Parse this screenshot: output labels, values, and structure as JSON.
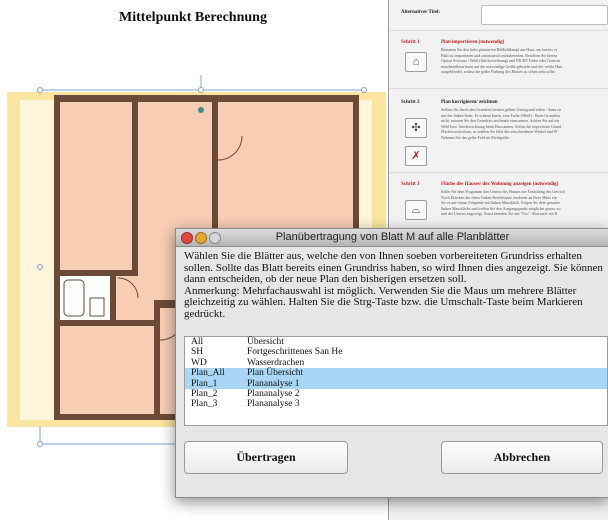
{
  "document": {
    "title": "Mittelpunkt Berechnung"
  },
  "right_panel": {
    "alt_title_label": "Alternativer Titel:",
    "alt_title_value": "",
    "steps": [
      {
        "step": "Schritt 1",
        "title": "Plan importieren (notwendig)",
        "text": [
          "Benutzen Sie den links platzierten Bildbildknopf um Haus, am bereits ei",
          "Blatt zu importieren und automatisch aufzubereiten. Beachten Sie hierzu",
          "Option Schwarz / Weiß (Strichzeichnung) und NICHT Farbe oder Graustu",
          "maschinelleserlesen auf die notwendige Größe gebracht und der weiße Hint",
          "ausgeblendet, sodass die gelbe Färbung des Blattes zu sehen sein sollte."
        ]
      },
      {
        "step": "Schritt 2",
        "title": "Plan korrigieren/ zeichnen",
        "text": [
          "Sollten Sie durch den Grundriss keinen gelben Untergrund sehen - dann zu",
          "mit der linken Seite. Es scheint Innen, eine Farbe (Weiß) - Ihren Grundriss",
          "nicht, müssen Sie den Grundriss nochmals einscannen. Achten Sie auf ein",
          "Weiß bzw. Strichzeichnung beim Einscannen. Sollen die importierte Grund",
          "Flächen aufweisen, so wählen Sie hilfe die verschiedenen Winkel und W",
          "Nehmen Sie das gelbe Feld als Richtgröße."
        ]
      },
      {
        "step": "Schritt 3",
        "title": "Fläche des Hauses/ der Wohnung anzeigen (notwendig)",
        "text": [
          "Sollte Sie dem Programm den Umriss des Hauses zur Ermittlung des Gewich",
          "Noch Drücken der obere linken Befehlstaste erscheint an Ihrer Maus ein",
          "Sie es auf einem Eckpunkt mit linken Mausklick. Folgen Sie dem gesamte",
          "linken Mausklicks und treffen Sie den Ausgangspunkt möglichst genau, so",
          "und der Umriss angezeigt. Sonst beenden Sie mit \"Esc\". Alternativ ein K"
        ]
      }
    ]
  },
  "dialog": {
    "title": "Planübertragung von Blatt M auf alle Planblätter",
    "message_lines": [
      "Wählen Sie die Blätter aus, welche den von Ihnen soeben vorbereiteten Grundriss erhalten",
      "sollen. Sollte das Blatt bereits einen Grundriss haben, so wird Ihnen dies angezeigt. Sie können",
      "dann entscheiden, ob der neue Plan den bisherigen ersetzen soll.",
      "Anmerkung: Mehrfachauswahl ist möglich. Verwenden Sie die Maus um mehrere Blätter",
      "gleichzeitig zu wählen. Halten Sie die  Strg-Taste bzw. die Umschalt-Taste beim Markieren",
      "gedrückt."
    ],
    "sheets": [
      {
        "code": "All",
        "name": "Übersicht",
        "selected": false
      },
      {
        "code": "SH",
        "name": "Fortgeschrittenes San He",
        "selected": false
      },
      {
        "code": "WD",
        "name": "Wasserdrachen",
        "selected": false
      },
      {
        "code": "Plan_All",
        "name": "Plan Übersicht",
        "selected": true
      },
      {
        "code": "Plan_1",
        "name": "Plananalyse 1",
        "selected": true
      },
      {
        "code": "Plan_2",
        "name": "Plananalyse 2",
        "selected": false
      },
      {
        "code": "Plan_3",
        "name": "Plananalyse 3",
        "selected": false
      }
    ],
    "buttons": {
      "transfer": "Übertragen",
      "cancel": "Abbrechen"
    }
  },
  "colors": {
    "room_fill": "#f7cdb4",
    "frame_yellow": "#fbe5a0",
    "wall": "#6b4a37",
    "selection_line": "#7fa4d6",
    "handle": "#3a8f86",
    "step_red": "#c41a1a",
    "list_selected": "#a9d6f5"
  },
  "icons": {
    "step1": "home-icon",
    "step2a": "move-icon",
    "step2b": "cross-out-icon",
    "step3": "area-icon"
  }
}
